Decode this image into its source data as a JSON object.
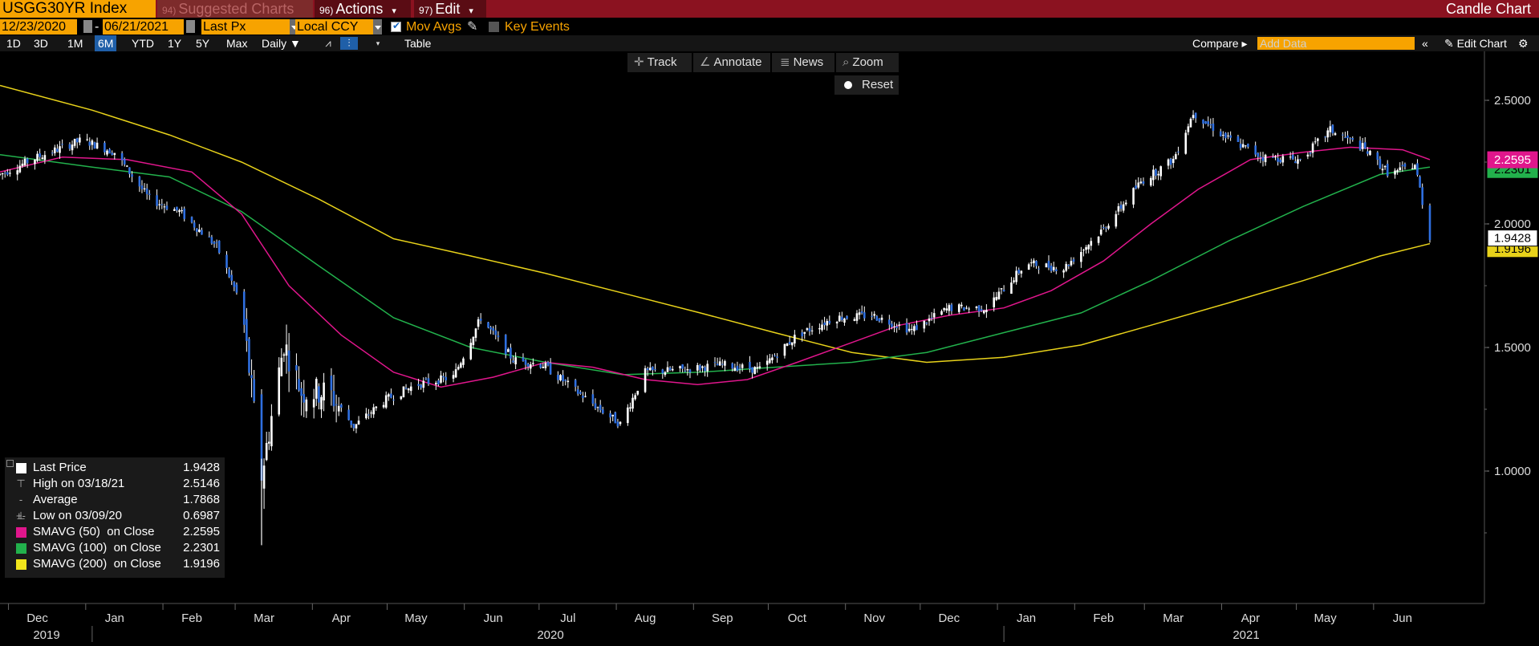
{
  "topbar": {
    "ticker": "USGG30YR Index",
    "suggested_num": "94)",
    "suggested_label": "Suggested Charts",
    "actions_num": "96)",
    "actions_label": "Actions",
    "edit_num": "97)",
    "edit_label": "Edit",
    "title": "Candle Chart"
  },
  "controls": {
    "start_date": "12/23/2020",
    "date_sep": "-",
    "end_date": "06/21/2021",
    "field": "Last Px",
    "currency": "Local CCY",
    "mov_avgs_label": "Mov Avgs",
    "mov_avgs_checked": true,
    "key_events_label": "Key Events",
    "key_events_checked": false
  },
  "periods": [
    "1D",
    "3D",
    "1M",
    "6M",
    "YTD",
    "1Y",
    "5Y",
    "Max"
  ],
  "active_period": "6M",
  "frequency": "Daily ▼",
  "table_label": "Table",
  "compare_label": "Compare ▸",
  "add_data_placeholder": "Add Data",
  "edit_chart_label": "Edit Chart",
  "chart_tools": {
    "track": "Track",
    "annotate": "Annotate",
    "news": "News",
    "zoom": "Zoom",
    "reset": "Reset"
  },
  "legend": {
    "last_price_label": "Last Price",
    "last_price_value": "1.9428",
    "high_label": "High on 03/18/21",
    "high_value": "2.5146",
    "average_label": "Average",
    "average_value": "1.7868",
    "low_label": "Low on 03/09/20",
    "low_value": "0.6987",
    "sma50_label": "SMAVG (50)  on Close",
    "sma50_value": "2.2595",
    "sma100_label": "SMAVG (100)  on Close",
    "sma100_value": "2.2301",
    "sma200_label": "SMAVG (200)  on Close",
    "sma200_value": "1.9196"
  },
  "colors": {
    "sma50": "#e0168c",
    "sma100": "#22b14c",
    "sma200": "#e8d21a",
    "candle": "#2f6fe0",
    "accent": "#f7a300",
    "bar": "#8b1220"
  },
  "chart_data": {
    "type": "candlestick",
    "y_ticks": [
      "2.5000",
      "2.0000",
      "1.5000",
      "1.0000"
    ],
    "ylim": [
      0.65,
      2.7
    ],
    "month_labels": [
      "Dec",
      "Jan",
      "Feb",
      "Mar",
      "Apr",
      "May",
      "Jun",
      "Jul",
      "Aug",
      "Sep",
      "Oct",
      "Nov",
      "Dec",
      "Jan",
      "Feb",
      "Mar",
      "Apr",
      "May",
      "Jun"
    ],
    "year_labels": [
      "2019",
      "2020",
      "2021"
    ],
    "last_price_tag": "1.9428",
    "sma50_tag": "2.2595",
    "sma100_tag": "2.2301",
    "sma200_tag": "1.9196",
    "close_path": {
      "dates": [
        "2019-11-25",
        "2019-12-10",
        "2019-12-28",
        "2020-01-10",
        "2020-01-24",
        "2020-02-05",
        "2020-02-20",
        "2020-03-01",
        "2020-03-09",
        "2020-03-18",
        "2020-03-25",
        "2020-04-05",
        "2020-04-15",
        "2020-04-28",
        "2020-05-10",
        "2020-05-25",
        "2020-06-05",
        "2020-06-18",
        "2020-06-30",
        "2020-07-15",
        "2020-07-31",
        "2020-08-10",
        "2020-08-25",
        "2020-09-10",
        "2020-09-25",
        "2020-10-10",
        "2020-10-25",
        "2020-11-09",
        "2020-11-25",
        "2020-12-10",
        "2020-12-25",
        "2021-01-10",
        "2021-01-25",
        "2021-02-10",
        "2021-02-25",
        "2021-03-10",
        "2021-03-18",
        "2021-03-31",
        "2021-04-15",
        "2021-04-30",
        "2021-05-12",
        "2021-05-25",
        "2021-06-05",
        "2021-06-15",
        "2021-06-21"
      ],
      "close": [
        2.2,
        2.27,
        2.34,
        2.29,
        2.1,
        2.05,
        1.91,
        1.67,
        0.98,
        1.52,
        1.32,
        1.32,
        1.18,
        1.29,
        1.35,
        1.38,
        1.62,
        1.45,
        1.43,
        1.31,
        1.19,
        1.4,
        1.41,
        1.43,
        1.41,
        1.55,
        1.62,
        1.63,
        1.57,
        1.66,
        1.66,
        1.84,
        1.82,
        1.98,
        2.17,
        2.26,
        2.45,
        2.35,
        2.27,
        2.26,
        2.38,
        2.31,
        2.2,
        2.24,
        1.94
      ]
    },
    "sma50": {
      "dates": [
        "2019-11-25",
        "2019-12-20",
        "2020-01-15",
        "2020-02-10",
        "2020-03-01",
        "2020-03-20",
        "2020-04-10",
        "2020-05-01",
        "2020-05-20",
        "2020-06-10",
        "2020-07-01",
        "2020-07-20",
        "2020-08-10",
        "2020-08-31",
        "2020-09-20",
        "2020-10-10",
        "2020-11-01",
        "2020-11-20",
        "2020-12-10",
        "2021-01-01",
        "2021-01-20",
        "2021-02-10",
        "2021-03-01",
        "2021-03-20",
        "2021-04-10",
        "2021-05-01",
        "2021-05-20",
        "2021-06-10",
        "2021-06-21"
      ],
      "values": [
        2.21,
        2.27,
        2.26,
        2.21,
        2.04,
        1.75,
        1.55,
        1.4,
        1.34,
        1.38,
        1.44,
        1.42,
        1.37,
        1.35,
        1.37,
        1.44,
        1.52,
        1.59,
        1.63,
        1.66,
        1.73,
        1.85,
        2.0,
        2.14,
        2.26,
        2.29,
        2.31,
        2.3,
        2.26
      ]
    },
    "sma100": {
      "dates": [
        "2019-11-25",
        "2020-01-01",
        "2020-02-01",
        "2020-03-01",
        "2020-04-01",
        "2020-05-01",
        "2020-06-01",
        "2020-07-01",
        "2020-08-01",
        "2020-09-01",
        "2020-10-01",
        "2020-11-01",
        "2020-12-01",
        "2021-01-01",
        "2021-02-01",
        "2021-03-01",
        "2021-04-01",
        "2021-05-01",
        "2021-06-01",
        "2021-06-21"
      ],
      "values": [
        2.28,
        2.23,
        2.19,
        2.05,
        1.83,
        1.62,
        1.5,
        1.44,
        1.39,
        1.4,
        1.42,
        1.44,
        1.48,
        1.56,
        1.64,
        1.77,
        1.93,
        2.07,
        2.2,
        2.23
      ]
    },
    "sma200": {
      "dates": [
        "2019-11-25",
        "2020-01-01",
        "2020-02-01",
        "2020-03-01",
        "2020-04-01",
        "2020-05-01",
        "2020-06-01",
        "2020-07-01",
        "2020-08-01",
        "2020-09-01",
        "2020-10-01",
        "2020-11-01",
        "2020-12-01",
        "2021-01-01",
        "2021-02-01",
        "2021-03-01",
        "2021-04-01",
        "2021-05-01",
        "2021-06-01",
        "2021-06-21"
      ],
      "values": [
        2.56,
        2.46,
        2.36,
        2.25,
        2.1,
        1.94,
        1.87,
        1.8,
        1.72,
        1.64,
        1.56,
        1.48,
        1.44,
        1.46,
        1.51,
        1.59,
        1.68,
        1.77,
        1.87,
        1.92
      ]
    }
  }
}
